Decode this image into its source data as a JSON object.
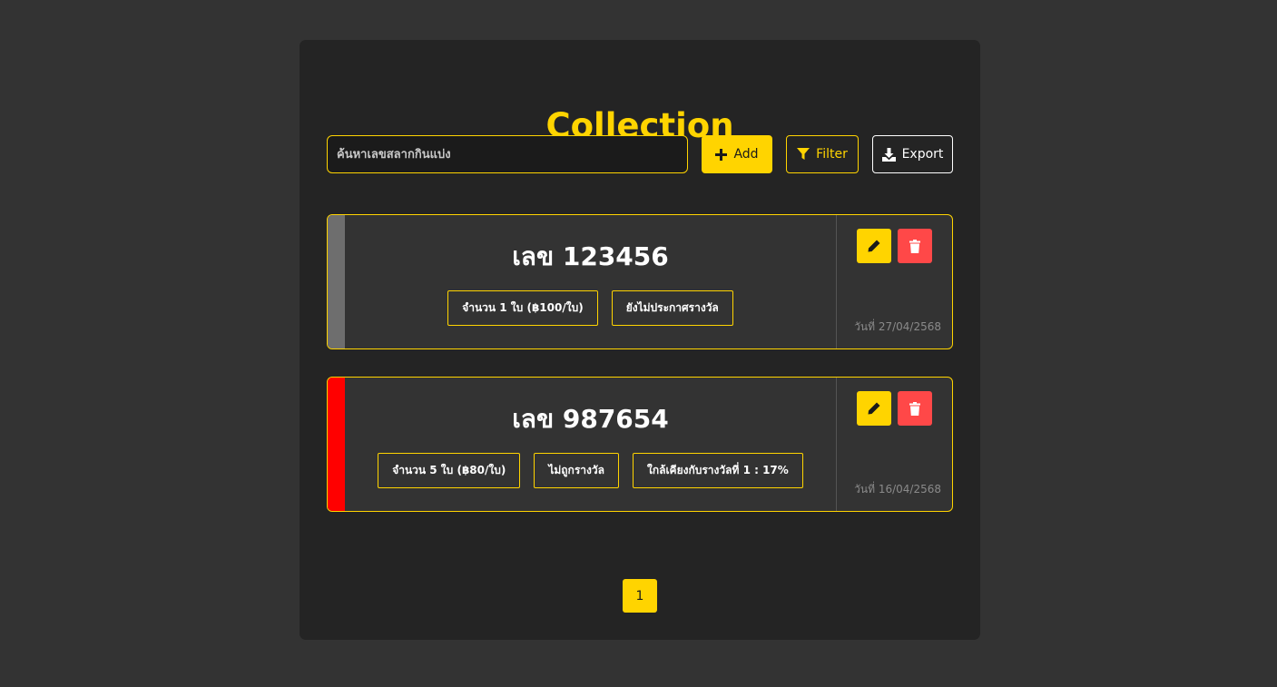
{
  "header": {
    "title": "Collection"
  },
  "toolbar": {
    "search_placeholder": "ค้นหาเลขสลากกินแบ่ง",
    "add_label": "Add",
    "filter_label": "Filter",
    "export_label": "Export"
  },
  "cards": [
    {
      "number": "เลข 123456",
      "stripe_color": "#6e6e6e",
      "tags": [
        "จำนวน 1 ใบ (฿100/ใบ)",
        "ยังไม่ประกาศรางวัล"
      ],
      "date": "วันที่ 27/04/2568"
    },
    {
      "number": "เลข 987654",
      "stripe_color": "#ff0000",
      "tags": [
        "จำนวน 5 ใบ (฿80/ใบ)",
        "ไม่ถูกรางวัล",
        "ใกล้เคียงกับรางวัลที่ 1 : 17%"
      ],
      "date": "วันที่ 16/04/2568"
    }
  ],
  "pagination": {
    "current": "1"
  },
  "icons": {
    "add": "plus-icon",
    "filter": "funnel-icon",
    "export": "download-icon",
    "edit": "pencil-icon",
    "delete": "trash-icon"
  },
  "colors": {
    "accent": "#ffd400",
    "danger": "#ff4848",
    "background": "#333333",
    "panel": "#242424"
  }
}
